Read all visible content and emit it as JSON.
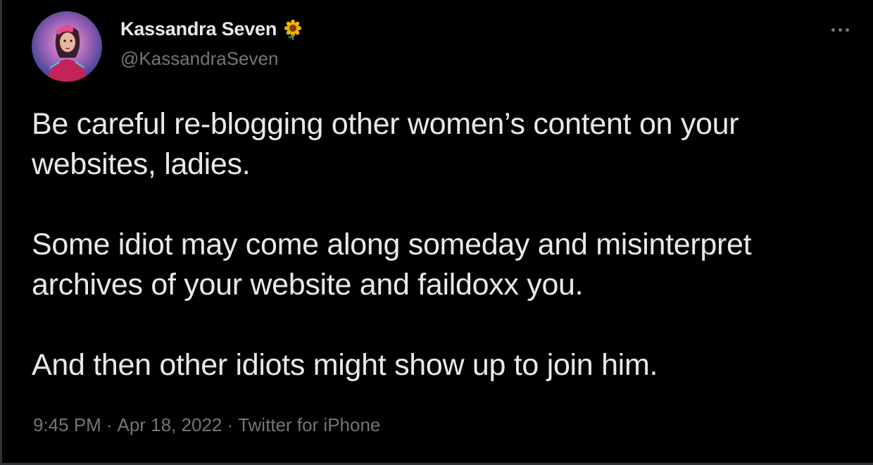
{
  "author": {
    "display_name": "Kassandra Seven",
    "handle": "@KassandraSeven",
    "badge_icon": "sunflower-icon",
    "avatar_icon": "profile-avatar"
  },
  "tweet": {
    "paragraphs": [
      {
        "line1": "Be careful re-blogging other women’s content on your",
        "line2": "websites, ladies."
      },
      {
        "line1": "Some idiot may come along someday and misinterpret",
        "line2": "archives of your website and faildoxx you."
      },
      {
        "line1": "And then other idiots might show up to join him.",
        "line2": ""
      }
    ]
  },
  "meta": {
    "time": "9:45 PM",
    "separator": "·",
    "date": "Apr 18, 2022",
    "source": "Twitter for iPhone"
  },
  "menu": {
    "more_icon": "more-options-icon"
  },
  "colors": {
    "background": "#000000",
    "text_primary": "#e7e9ea",
    "text_secondary": "#71767b"
  }
}
